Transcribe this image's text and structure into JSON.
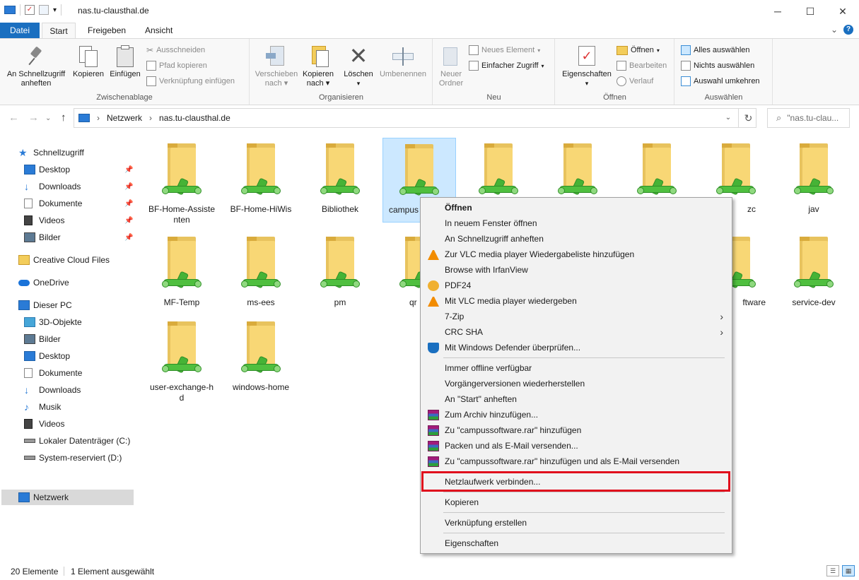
{
  "window": {
    "title": "nas.tu-clausthal.de",
    "minimize": "─",
    "maximize": "☐",
    "close": "✕",
    "qat_dropdown": "▾"
  },
  "ribbon_tabs": {
    "file": "Datei",
    "start": "Start",
    "share": "Freigeben",
    "view": "Ansicht",
    "expand": "⌄",
    "help": "?"
  },
  "ribbon": {
    "clipboard": {
      "label": "Zwischenablage",
      "pin_line1": "An Schnellzugriff",
      "pin_line2": "anheften",
      "copy": "Kopieren",
      "paste": "Einfügen",
      "cut": "Ausschneiden",
      "copy_path": "Pfad kopieren",
      "paste_shortcut": "Verknüpfung einfügen"
    },
    "organize": {
      "label": "Organisieren",
      "move_line1": "Verschieben",
      "move_line2": "nach",
      "copyto_line1": "Kopieren",
      "copyto_line2": "nach",
      "delete": "Löschen",
      "rename": "Umbenennen"
    },
    "new": {
      "label": "Neu",
      "folder_line1": "Neuer",
      "folder_line2": "Ordner",
      "new_item": "Neues Element",
      "easy_access": "Einfacher Zugriff"
    },
    "open": {
      "label": "Öffnen",
      "properties": "Eigenschaften",
      "open": "Öffnen",
      "edit": "Bearbeiten",
      "history": "Verlauf"
    },
    "select": {
      "label": "Auswählen",
      "select_all": "Alles auswählen",
      "select_none": "Nichts auswählen",
      "invert": "Auswahl umkehren"
    }
  },
  "navigation": {
    "back": "←",
    "forward": "→",
    "recent": "⌄",
    "up": "↑",
    "breadcrumb_network": "Netzwerk",
    "breadcrumb_host": "nas.tu-clausthal.de",
    "separator": "›",
    "dropdown": "⌄",
    "refresh": "↻",
    "search_icon": "⌕",
    "search_placeholder": "\"nas.tu-clau..."
  },
  "sidebar": {
    "pin": "📌",
    "quick_access": "Schnellzugriff",
    "qa_desktop": "Desktop",
    "qa_downloads": "Downloads",
    "qa_documents": "Dokumente",
    "qa_videos": "Videos",
    "qa_pictures": "Bilder",
    "creative_cloud": "Creative Cloud Files",
    "onedrive": "OneDrive",
    "this_pc": "Dieser PC",
    "pc_3d": "3D-Objekte",
    "pc_pictures": "Bilder",
    "pc_desktop": "Desktop",
    "pc_documents": "Dokumente",
    "pc_downloads": "Downloads",
    "pc_music": "Musik",
    "pc_videos": "Videos",
    "drive_c": "Lokaler Datenträger (C:)",
    "drive_d": "System-reserviert (D:)",
    "network": "Netzwerk"
  },
  "files": [
    "BF-Home-Assistenten",
    "BF-Home-HiWis",
    "Bibliothek",
    "campus",
    "",
    "",
    "",
    "zc",
    "jav",
    "MF-Temp",
    "ms-ees",
    "pm",
    "qr",
    "ftware",
    "service-dev",
    "user-exchange-hd",
    "windows-home"
  ],
  "context_menu": {
    "open": "Öffnen",
    "open_new_window": "In neuem Fenster öffnen",
    "pin_quick": "An Schnellzugriff anheften",
    "vlc_playlist": "Zur VLC media player Wiedergabeliste hinzufügen",
    "irfanview": "Browse with IrfanView",
    "pdf24": "PDF24",
    "vlc_play": "Mit VLC media player wiedergeben",
    "sevenzip": "7-Zip",
    "crc": "CRC SHA",
    "defender": "Mit Windows Defender überprüfen...",
    "offline": "Immer offline verfügbar",
    "restore": "Vorgängerversionen wiederherstellen",
    "pin_start": "An \"Start\" anheften",
    "add_archive": "Zum Archiv hinzufügen...",
    "add_rar": "Zu \"campussoftware.rar\" hinzufügen",
    "pack_email": "Packen und als E-Mail versenden...",
    "rar_email": "Zu \"campussoftware.rar\" hinzufügen und als E-Mail versenden",
    "map_drive": "Netzlaufwerk verbinden...",
    "copy": "Kopieren",
    "shortcut": "Verknüpfung erstellen",
    "properties": "Eigenschaften",
    "submenu_arrow": "›"
  },
  "status": {
    "count": "20 Elemente",
    "selection": "1 Element ausgewählt",
    "view_details": "☰",
    "view_icons": "▦"
  },
  "colors": {
    "accent": "#1a6fc0",
    "selection": "#cce8ff",
    "highlight_frame": "#e00c1c"
  }
}
